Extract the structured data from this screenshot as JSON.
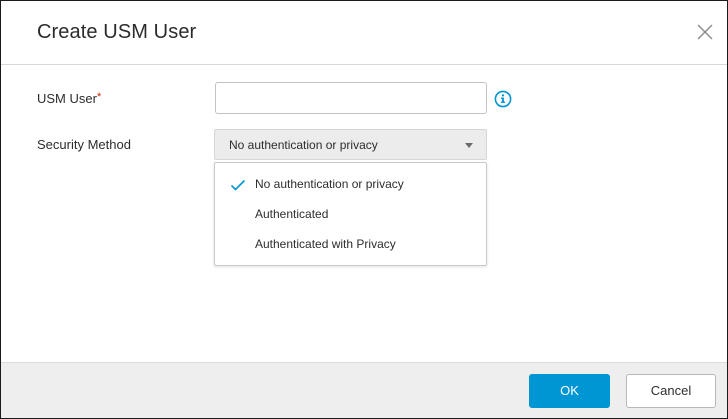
{
  "dialog": {
    "title": "Create USM User",
    "close_icon": "close-icon"
  },
  "form": {
    "usm_user": {
      "label": "USM User",
      "required_mark": "*",
      "value": "",
      "placeholder": "",
      "info_icon": "info-icon"
    },
    "security_method": {
      "label": "Security Method",
      "selected": "No authentication or privacy",
      "caret_icon": "caret-down-icon",
      "options": [
        {
          "label": "No authentication or privacy",
          "checked": true
        },
        {
          "label": "Authenticated",
          "checked": false
        },
        {
          "label": "Authenticated with Privacy",
          "checked": false
        }
      ]
    }
  },
  "footer": {
    "ok_label": "OK",
    "cancel_label": "Cancel"
  },
  "colors": {
    "accent": "#0095d3",
    "required": "#c92100",
    "check": "#0095d3"
  }
}
